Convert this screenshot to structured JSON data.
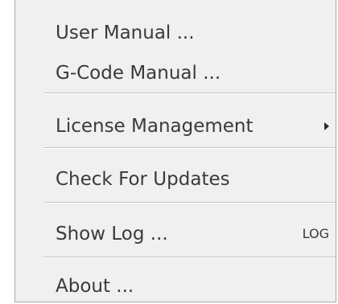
{
  "menu": {
    "items": [
      {
        "label": "User Manual ..."
      },
      {
        "label": "G-Code Manual ..."
      },
      {
        "label": "License Management"
      },
      {
        "label": "Check For Updates"
      },
      {
        "label": "Show Log ...",
        "shortcut": "LOG"
      },
      {
        "label": "About ..."
      }
    ],
    "submenu_arrow_icon": "chevron-right-icon"
  }
}
